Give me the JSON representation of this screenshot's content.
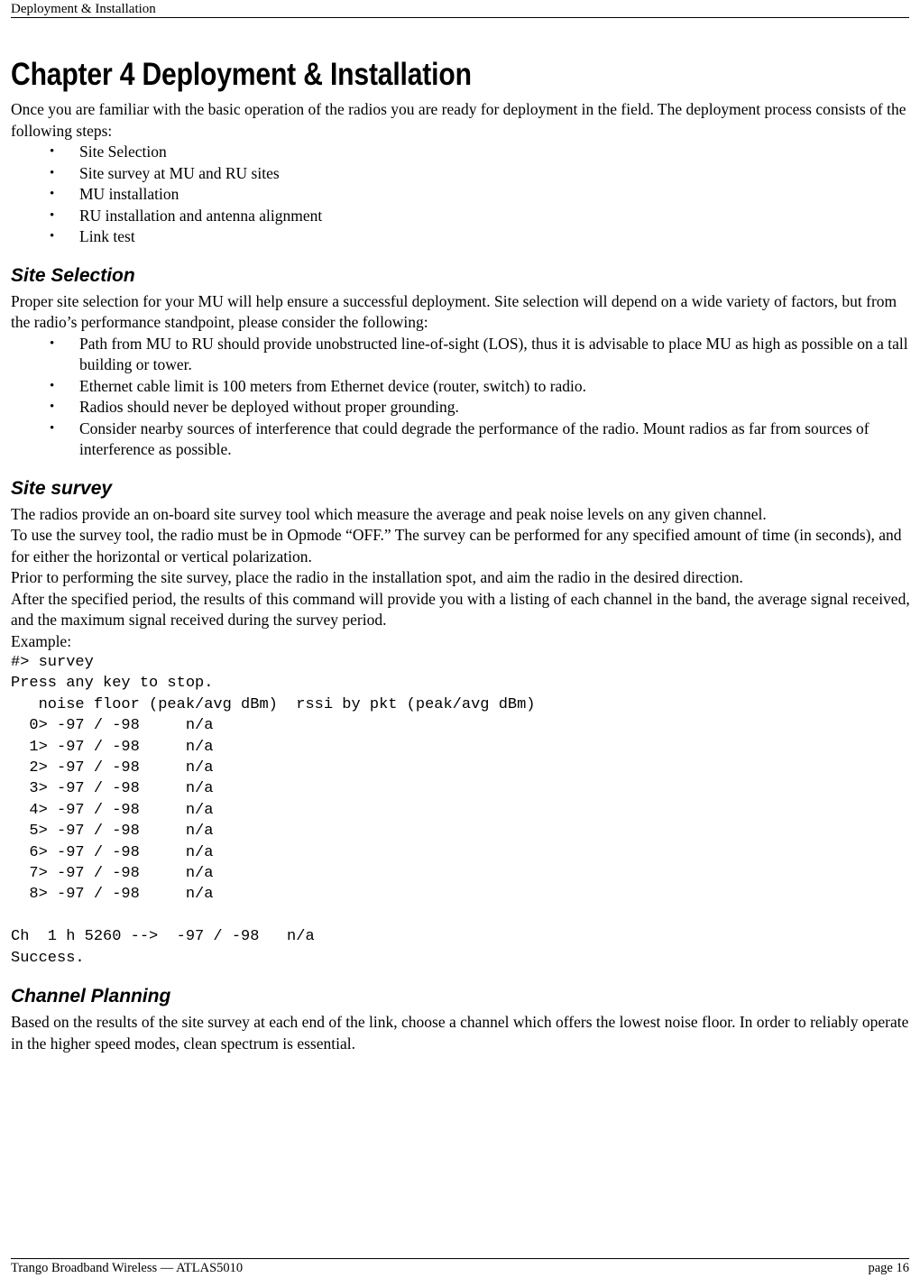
{
  "header": {
    "running_title": "Deployment & Installation"
  },
  "footer": {
    "left": "Trango Broadband Wireless — ATLAS5010",
    "right": "page 16"
  },
  "chapter": {
    "title": "Chapter 4 Deployment & Installation",
    "intro": "Once you are familiar with the basic operation of the radios you are ready for deployment in the field.  The deployment process consists of the following steps:",
    "steps": [
      "Site Selection",
      "Site survey at MU and RU sites",
      "MU installation",
      "RU installation and antenna alignment",
      "Link test"
    ],
    "bullet_glyph": "•"
  },
  "site_selection": {
    "heading": "Site Selection",
    "intro": "Proper site selection for your MU will help ensure a successful deployment.   Site selection will depend on a wide variety of factors, but from the radio’s performance standpoint, please consider the following:",
    "bullets": [
      "Path from MU to RU should provide unobstructed line-of-sight (LOS), thus it is advisable to place MU as high as possible on a tall building or tower.",
      "Ethernet cable limit is 100 meters from Ethernet device (router, switch) to radio.",
      "Radios should never be deployed without proper grounding.",
      "Consider nearby sources of interference that could degrade the performance of the radio.  Mount radios as far from sources of interference as possible."
    ]
  },
  "site_survey": {
    "heading": "Site survey",
    "paragraphs": [
      "The radios provide an on-board site survey tool which measure the average and peak noise levels on any given channel.",
      "To use the survey tool, the radio must be in Opmode “OFF.”  The survey can be performed for any specified amount of time (in seconds), and for either the horizontal or vertical polarization.",
      "Prior to performing the site survey, place the radio in the installation spot, and aim the radio in the desired direction.",
      "After the specified period, the results of this command will provide you with a listing of each channel in the band, the average signal received, and the maximum signal received during the survey period."
    ],
    "example_label": "Example:",
    "terminal_output": "#> survey\nPress any key to stop.\n   noise floor (peak/avg dBm)  rssi by pkt (peak/avg dBm)\n  0> -97 / -98     n/a\n  1> -97 / -98     n/a\n  2> -97 / -98     n/a\n  3> -97 / -98     n/a\n  4> -97 / -98     n/a\n  5> -97 / -98     n/a\n  6> -97 / -98     n/a\n  7> -97 / -98     n/a\n  8> -97 / -98     n/a\n\nCh  1 h 5260 -->  -97 / -98   n/a\nSuccess."
  },
  "channel_planning": {
    "heading": "Channel Planning",
    "paragraph": "Based on the results of the site survey at each end of the link, choose a channel which offers the lowest noise floor.  In order to reliably operate in the higher speed modes, clean spectrum is essential."
  }
}
